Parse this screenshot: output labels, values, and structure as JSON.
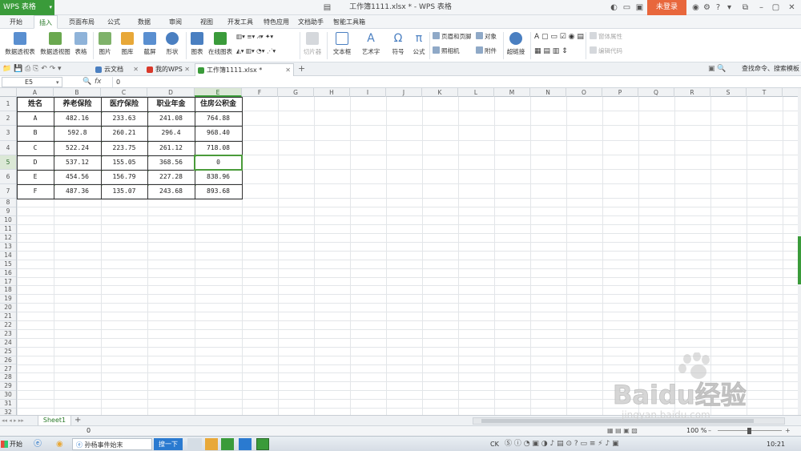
{
  "app": {
    "name": "WPS 表格",
    "window_title": "工作簿1111.xlsx * - WPS 表格",
    "login_label": "未登录"
  },
  "menu": {
    "tabs": [
      "开始",
      "插入",
      "页面布局",
      "公式",
      "数据",
      "审阅",
      "视图",
      "开发工具",
      "特色应用",
      "文档助手",
      "智能工具箱"
    ],
    "active_tab": "插入"
  },
  "ribbon": {
    "pivot_table": "数据透视表",
    "pivot_chart": "数据透视图",
    "table": "表格",
    "picture": "图片",
    "gallery": "图库",
    "screenshot": "截屏",
    "shapes": "形状",
    "chart": "图表",
    "online_chart": "在线图表",
    "slicer": "切片器",
    "textbox": "文本框",
    "wordart": "艺术字",
    "symbol": "符号",
    "formula": "公式",
    "header_footer": "页眉和页脚",
    "object": "对象",
    "camera": "照相机",
    "attachment": "附件",
    "hyperlink": "超链接",
    "form_properties": "窗体属性",
    "edit_code": "编辑代码"
  },
  "doc_tabs": {
    "cloud": "云文档",
    "mywps": "我的WPS",
    "workbook": "工作簿1111.xlsx *",
    "right_links": [
      "查找命令、搜索模板"
    ]
  },
  "formula_bar": {
    "cell_ref": "E5",
    "fx": "fx",
    "value": "0"
  },
  "columns": [
    "A",
    "B",
    "C",
    "D",
    "E",
    "F",
    "G",
    "H",
    "I",
    "J",
    "K",
    "L",
    "M",
    "N",
    "O",
    "P",
    "Q",
    "R",
    "S",
    "T"
  ],
  "table": {
    "headers": [
      "姓名",
      "养老保险",
      "医疗保险",
      "职业年金",
      "住房公积金"
    ],
    "rows": [
      [
        "A",
        "482.16",
        "233.63",
        "241.08",
        "764.88"
      ],
      [
        "B",
        "592.8",
        "260.21",
        "296.4",
        "968.40"
      ],
      [
        "C",
        "522.24",
        "223.75",
        "261.12",
        "718.08"
      ],
      [
        "D",
        "537.12",
        "155.05",
        "368.56",
        "0"
      ],
      [
        "E",
        "454.56",
        "156.79",
        "227.28",
        "838.96"
      ],
      [
        "F",
        "487.36",
        "135.07",
        "243.68",
        "893.68"
      ]
    ]
  },
  "sheet": {
    "tab": "Sheet1",
    "add": "+"
  },
  "status": {
    "sum": "0",
    "zoom": "100 %"
  },
  "taskbar": {
    "start": "开始",
    "task1": "孙杨事件始末",
    "search_btn": "搜一下",
    "ime": "CK",
    "clock": "10:21"
  },
  "watermark": {
    "text": "Baidu经验",
    "url": "jingyan.baidu.com"
  }
}
